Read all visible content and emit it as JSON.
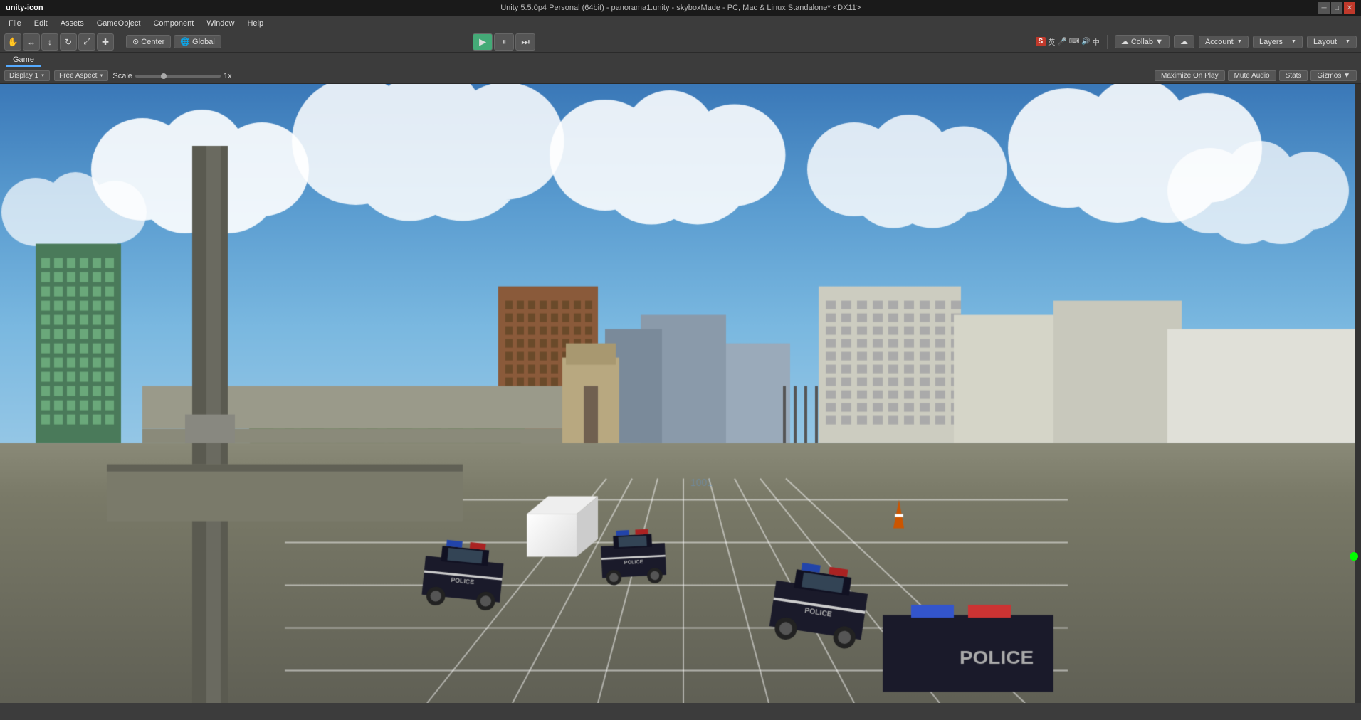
{
  "titleBar": {
    "icon": "unity-icon",
    "title": "Unity 5.5.0p4 Personal (64bit) - panorama1.unity - skyboxMade - PC, Mac & Linux Standalone* <DX11>",
    "minimize": "─",
    "maximize": "□",
    "close": "✕"
  },
  "menuBar": {
    "items": [
      "File",
      "Edit",
      "Assets",
      "GameObject",
      "Component",
      "Window",
      "Help"
    ]
  },
  "toolbar": {
    "tools": [
      "✋",
      "↔",
      "↕",
      "↻",
      "⤢"
    ],
    "pivotMode": "Center",
    "coordMode": "Global",
    "playBtn": "▶",
    "pauseBtn": "⏸",
    "stepBtn": "⏭"
  },
  "rightToolbar": {
    "collab": "Collab ▼",
    "cloudIcon": "☁",
    "account": "Account",
    "layers": "Layers",
    "layout": "Layout"
  },
  "gamePanel": {
    "tab": "Game",
    "display": "Display 1",
    "aspectRatio": "Free Aspect",
    "scaleLabel": "Scale",
    "scaleValue": "1x",
    "buttons": [
      "Maximize On Play",
      "Mute Audio",
      "Stats",
      "Gizmos"
    ]
  },
  "colors": {
    "bg": "#3c3c3c",
    "darker": "#2a2a2a",
    "toolbar": "#555555",
    "accent": "#5af"
  }
}
